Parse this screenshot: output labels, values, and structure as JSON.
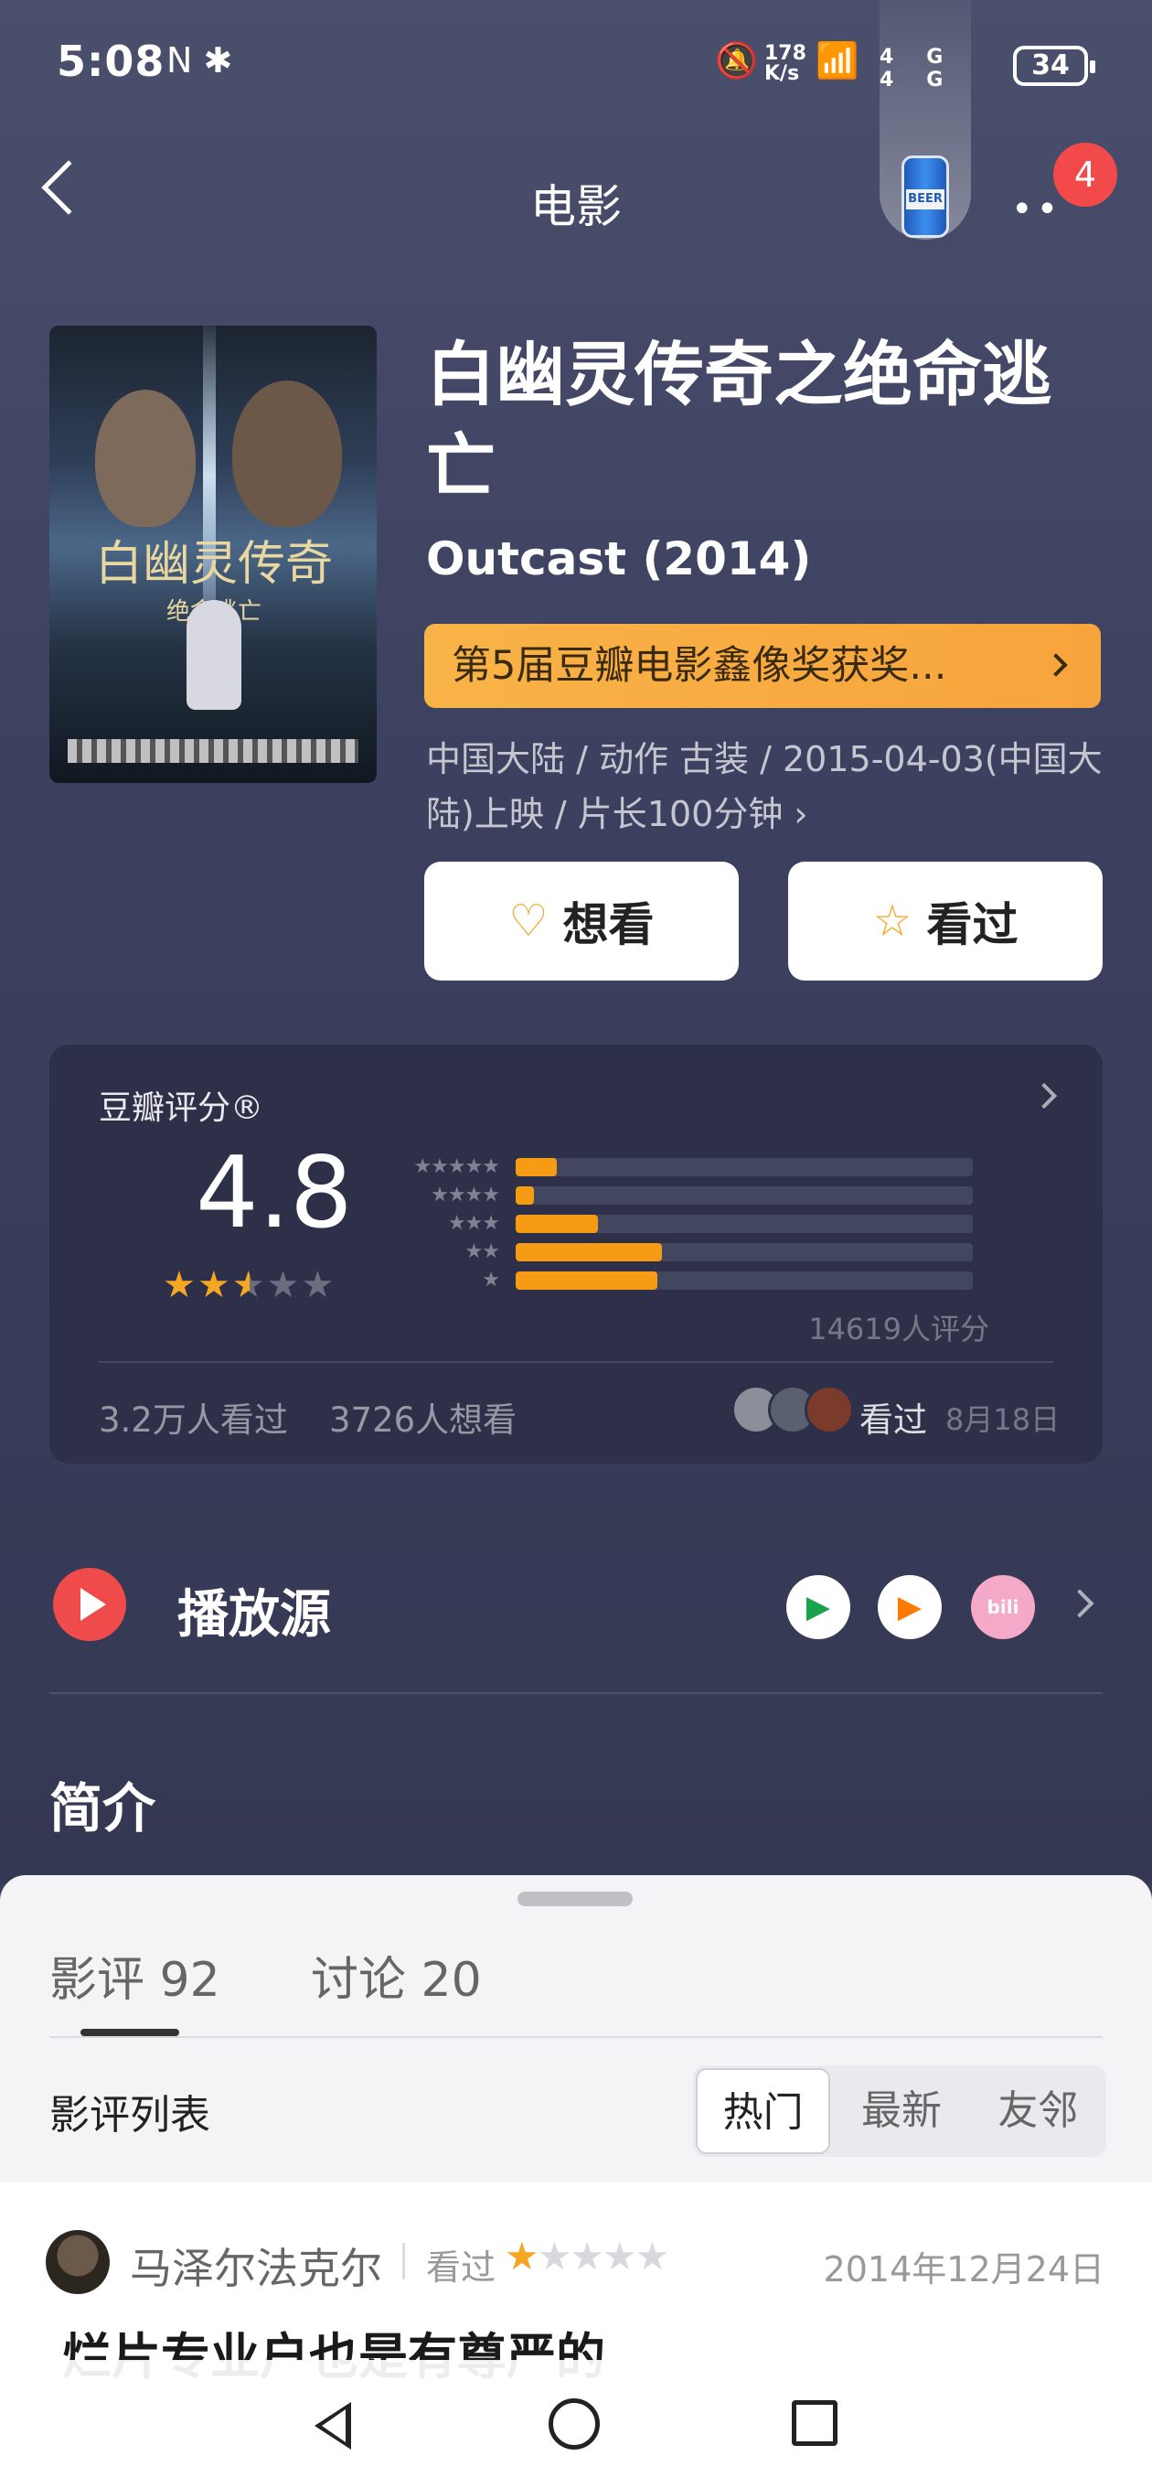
{
  "status_bar": {
    "time": "5:08",
    "left_icons": "N ✱",
    "net_speed": "178 K/s",
    "signal_text": "4G 4G",
    "battery": "34"
  },
  "header": {
    "title": "电影",
    "badge_count": "4"
  },
  "movie": {
    "title_cn": "白幽灵传奇之绝命逃亡",
    "title_en": "Outcast (2014)",
    "award": "第5届豆瓣电影鑫像奖获奖...",
    "meta": "中国大陆 / 动作 古装 / 2015-04-03(中国大陆)上映 / 片长100分钟 ›",
    "poster_title": "白幽灵传奇",
    "poster_subtitle": "绝命逃亡"
  },
  "actions": {
    "want_label": "想看",
    "seen_label": "看过"
  },
  "rating": {
    "label": "豆瓣评分®",
    "score": "4.8",
    "score_stars": 2.5,
    "distribution": [
      {
        "stars": "★★★★★",
        "fraction": 0.09
      },
      {
        "stars": "★★★★",
        "fraction": 0.04
      },
      {
        "stars": "★★★",
        "fraction": 0.18
      },
      {
        "stars": "★★",
        "fraction": 0.32
      },
      {
        "stars": "★",
        "fraction": 0.31
      }
    ],
    "count": "14619人评分",
    "watched": "3.2万人看过",
    "wish": "3726人想看",
    "friend_status": "看过",
    "friend_date": "8月18日"
  },
  "play_source": {
    "label": "播放源"
  },
  "intro": {
    "label": "简介"
  },
  "sheet": {
    "tabs": [
      {
        "label": "影评 92"
      },
      {
        "label": "讨论 20"
      }
    ],
    "list_title": "影评列表",
    "sort_options": [
      {
        "label": "热门"
      },
      {
        "label": "最新"
      },
      {
        "label": "友邻"
      }
    ],
    "review": {
      "author": "马泽尔法克尔",
      "status": "看过",
      "stars": 1,
      "date": "2014年12月24日",
      "title": "烂片专业户也是有尊严的"
    }
  },
  "colors": {
    "accent_orange": "#f69b14",
    "star_orange": "#f5a623",
    "play_red": "#f04b4b",
    "badge_red": "#f24a4a"
  }
}
